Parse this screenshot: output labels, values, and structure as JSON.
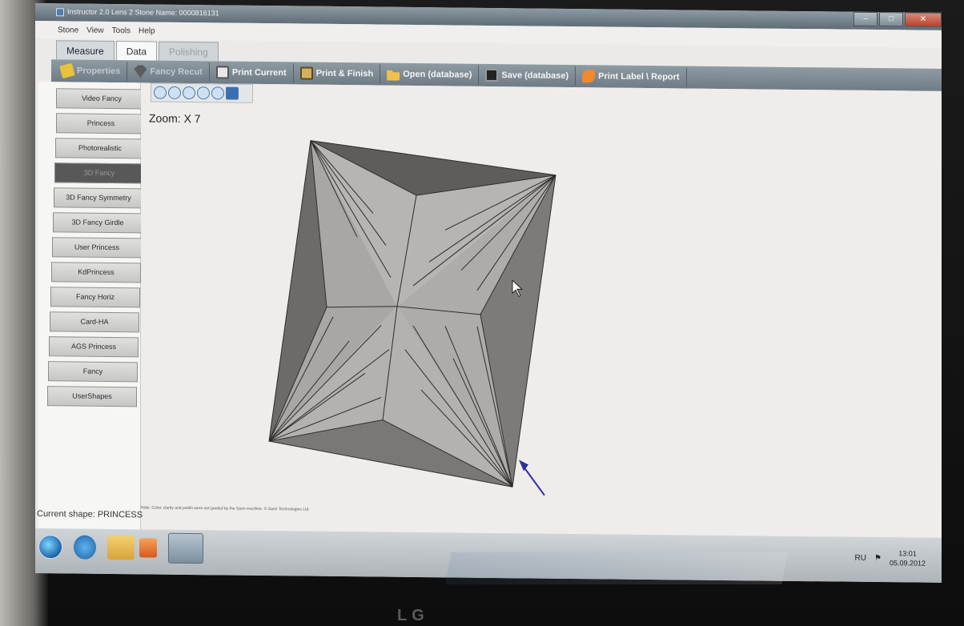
{
  "window": {
    "title": "Instructor 2.0 Lens 2 Stone Name: 0000816131"
  },
  "menu": [
    "Stone",
    "View",
    "Tools",
    "Help"
  ],
  "tabs": [
    {
      "label": "Measure",
      "state": "normal"
    },
    {
      "label": "Data",
      "state": "active"
    },
    {
      "label": "Polishing",
      "state": "disabled"
    }
  ],
  "toolbar": [
    {
      "label": "Properties",
      "icon": "properties-icon"
    },
    {
      "label": "Fancy Recut",
      "icon": "diamond-icon"
    },
    {
      "label": "Print Current",
      "icon": "printer-icon"
    },
    {
      "label": "Print & Finish",
      "icon": "print-finish-icon"
    },
    {
      "label": "Open (database)",
      "icon": "folder-open-icon"
    },
    {
      "label": "Save (database)",
      "icon": "floppy-disk-icon"
    },
    {
      "label": "Print Label \\ Report",
      "icon": "label-icon"
    }
  ],
  "shapes": [
    {
      "label": "Video Fancy"
    },
    {
      "label": "Princess"
    },
    {
      "label": "Photorealistic"
    },
    {
      "label": "3D Fancy",
      "selected": true
    },
    {
      "label": "3D Fancy Symmetry"
    },
    {
      "label": "3D Fancy Girdle"
    },
    {
      "label": "User Princess"
    },
    {
      "label": "KdPrincess"
    },
    {
      "label": "Fancy Horiz"
    },
    {
      "label": "Card-HA"
    },
    {
      "label": "AGS Princess"
    },
    {
      "label": "Fancy"
    },
    {
      "label": "UserShapes"
    }
  ],
  "view": {
    "zoom_label": "Zoom: X 7",
    "note": "Note: Color, clarity and polish were not graded by the Sarin machine. © Sarin Technologies Ltd."
  },
  "status": {
    "current_shape": "Current shape: PRINCESS"
  },
  "tray": {
    "lang": "RU",
    "time": "13:01",
    "date": "05.09.2012"
  },
  "brand": "LG",
  "colors": {
    "toolbar": "#7f8c95",
    "facet_dark": "#6f6d6b",
    "facet_light": "#b8b5b2",
    "direction_arrow": "#2b2fa0"
  }
}
